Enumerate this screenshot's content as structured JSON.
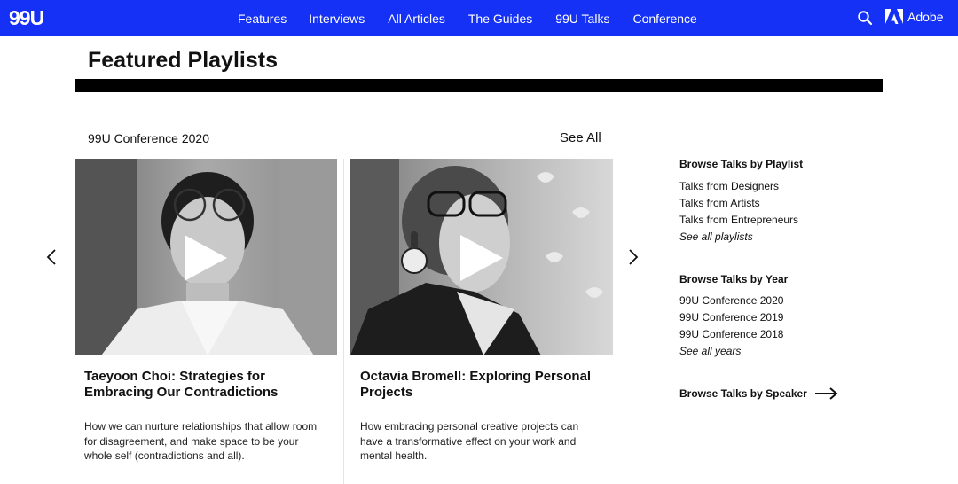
{
  "nav": {
    "logo": "99U",
    "links": [
      "Features",
      "Interviews",
      "All Articles",
      "The Guides",
      "99U Talks",
      "Conference"
    ],
    "adobe_label": "Adobe",
    "bg_color": "#1431f5"
  },
  "page": {
    "title": "Featured Playlists"
  },
  "playlist": {
    "name": "99U Conference 2020",
    "see_all": "See All",
    "cards": [
      {
        "title": "Taeyoon Choi: Strategies for Embracing Our Contradictions",
        "description": "How we can nurture relationships that allow room for disagreement, and make space to be your whole self (contradictions and all)."
      },
      {
        "title": "Octavia Bromell: Exploring Personal Projects",
        "description": "How embracing personal creative projects can have a transformative effect on your work and mental health."
      }
    ]
  },
  "sidebar": {
    "by_playlist": {
      "heading": "Browse Talks by Playlist",
      "items": [
        "Talks from Designers",
        "Talks from Artists",
        "Talks from Entrepreneurs"
      ],
      "see_all": "See all playlists"
    },
    "by_year": {
      "heading": "Browse Talks by Year",
      "items": [
        "99U Conference 2020",
        "99U Conference 2019",
        "99U Conference 2018"
      ],
      "see_all": "See all years"
    },
    "by_speaker": "Browse Talks by Speaker"
  },
  "icons": {
    "search": "search-icon",
    "adobe": "adobe-logo-icon",
    "play": "play-icon",
    "prev": "chevron-left-icon",
    "next": "chevron-right-icon",
    "speaker_arrow": "arrow-right-icon"
  }
}
